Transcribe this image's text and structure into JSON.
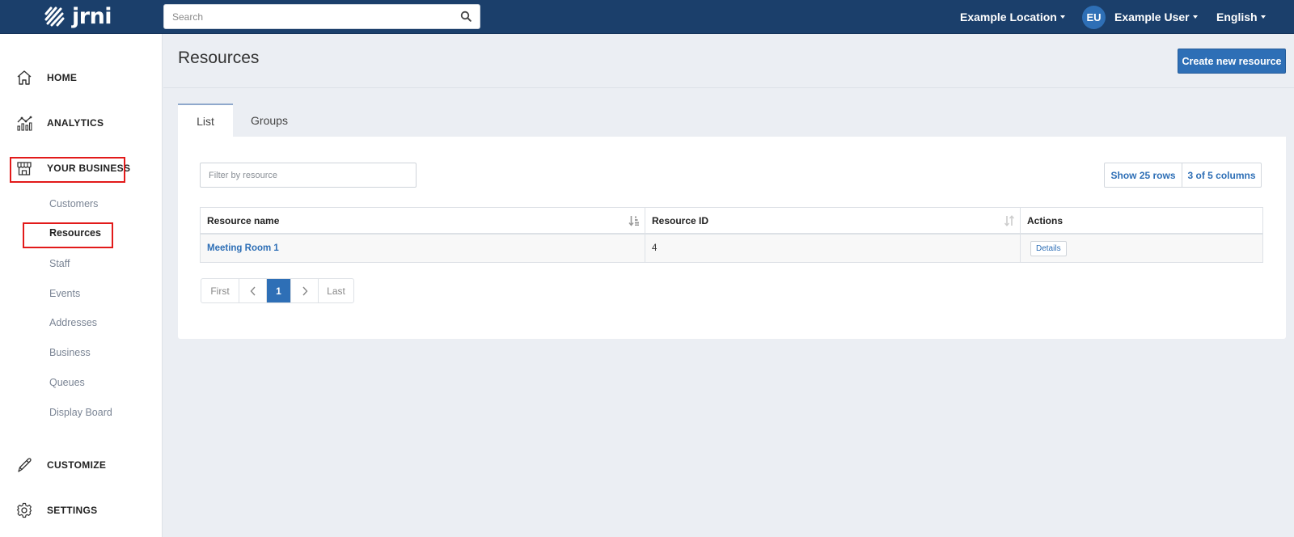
{
  "brand": {
    "name": "jrni"
  },
  "topbar": {
    "search_placeholder": "Search",
    "location": "Example Location",
    "user_initials": "EU",
    "user_name": "Example User",
    "language": "English"
  },
  "sidebar": {
    "main_items": [
      {
        "label": "HOME",
        "icon": "home-icon"
      },
      {
        "label": "ANALYTICS",
        "icon": "analytics-icon"
      },
      {
        "label": "YOUR BUSINESS",
        "icon": "storefront-icon",
        "highlighted": true
      },
      {
        "label": "CUSTOMIZE",
        "icon": "pencil-icon"
      },
      {
        "label": "SETTINGS",
        "icon": "gear-icon"
      }
    ],
    "sub_items": [
      {
        "label": "Customers"
      },
      {
        "label": "Resources",
        "active": true,
        "highlighted": true
      },
      {
        "label": "Staff"
      },
      {
        "label": "Events"
      },
      {
        "label": "Addresses"
      },
      {
        "label": "Business"
      },
      {
        "label": "Queues"
      },
      {
        "label": "Display Board"
      }
    ]
  },
  "page": {
    "title": "Resources",
    "create_button": "Create new resource",
    "tabs": [
      {
        "label": "List",
        "active": true
      },
      {
        "label": "Groups",
        "active": false
      }
    ],
    "filter_placeholder": "Filter by resource",
    "show_rows_button": "Show 25 rows",
    "columns_button": "3 of 5 columns",
    "table": {
      "headers": [
        "Resource name",
        "Resource ID",
        "Actions"
      ],
      "rows": [
        {
          "name": "Meeting Room 1",
          "id": "4",
          "action": "Details"
        }
      ]
    },
    "pagination": {
      "first": "First",
      "prev": "‹",
      "current": "1",
      "next": "›",
      "last": "Last"
    }
  },
  "colors": {
    "topbar": "#1b3f6b",
    "accent": "#2e6fb6",
    "highlight_box": "#e21a1a",
    "background": "#ebeef3"
  }
}
